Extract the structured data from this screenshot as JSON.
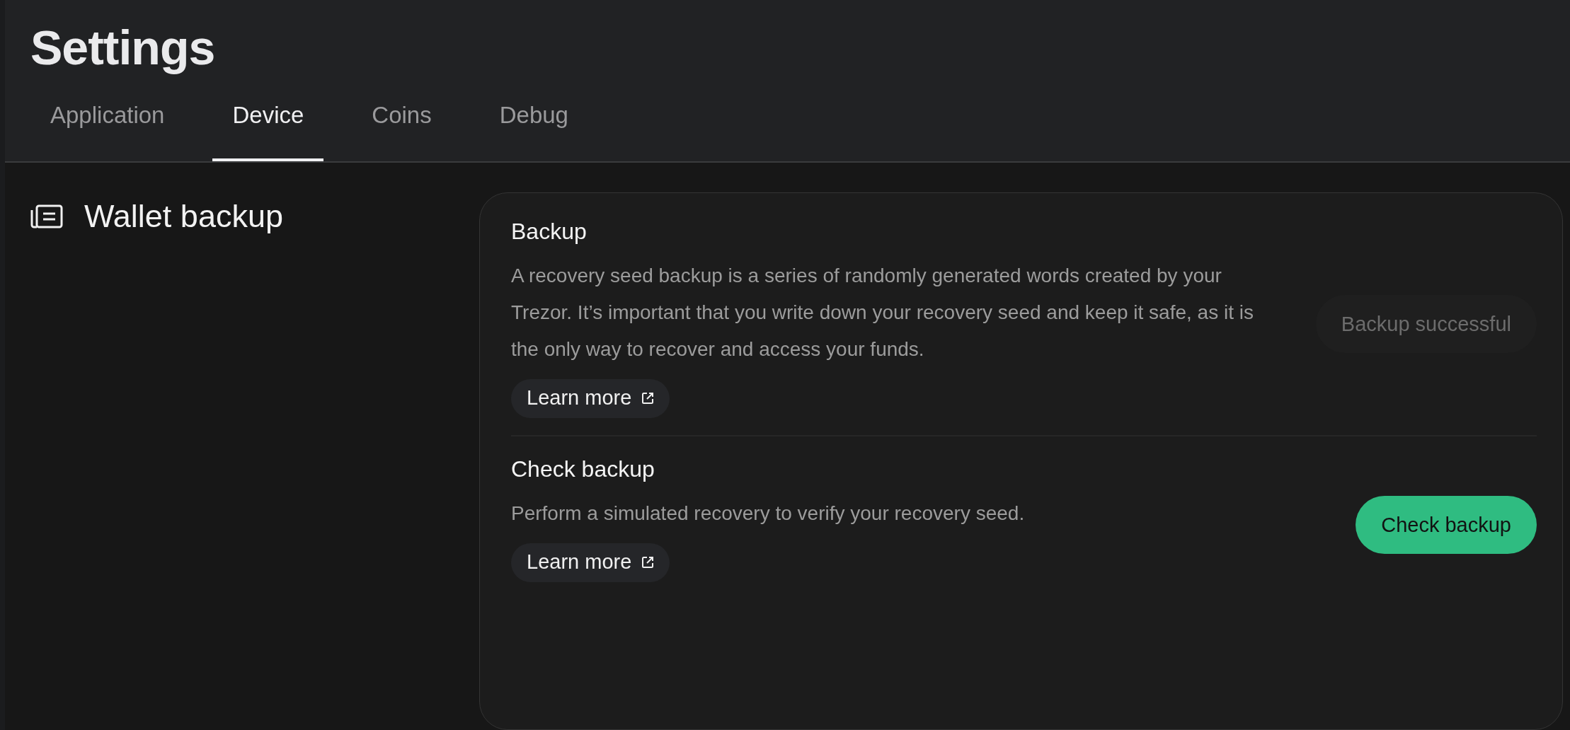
{
  "header": {
    "title": "Settings"
  },
  "tabs": [
    {
      "label": "Application",
      "selected": false
    },
    {
      "label": "Device",
      "selected": true
    },
    {
      "label": "Coins",
      "selected": false
    },
    {
      "label": "Debug",
      "selected": false
    }
  ],
  "section": {
    "title": "Wallet backup"
  },
  "settings": [
    {
      "title": "Backup",
      "description": "A recovery seed backup is a series of randomly generated words created by your Trezor. It’s important that you write down your recovery seed and keep it safe, as it is the only way to recover and access your funds.",
      "link": "Learn more",
      "action": {
        "label": "Backup successful",
        "disabled": true
      }
    },
    {
      "title": "Check backup",
      "description": "Perform a simulated recovery to verify your recovery seed.",
      "link": "Learn more",
      "action": {
        "label": "Check backup",
        "disabled": false
      }
    }
  ]
}
